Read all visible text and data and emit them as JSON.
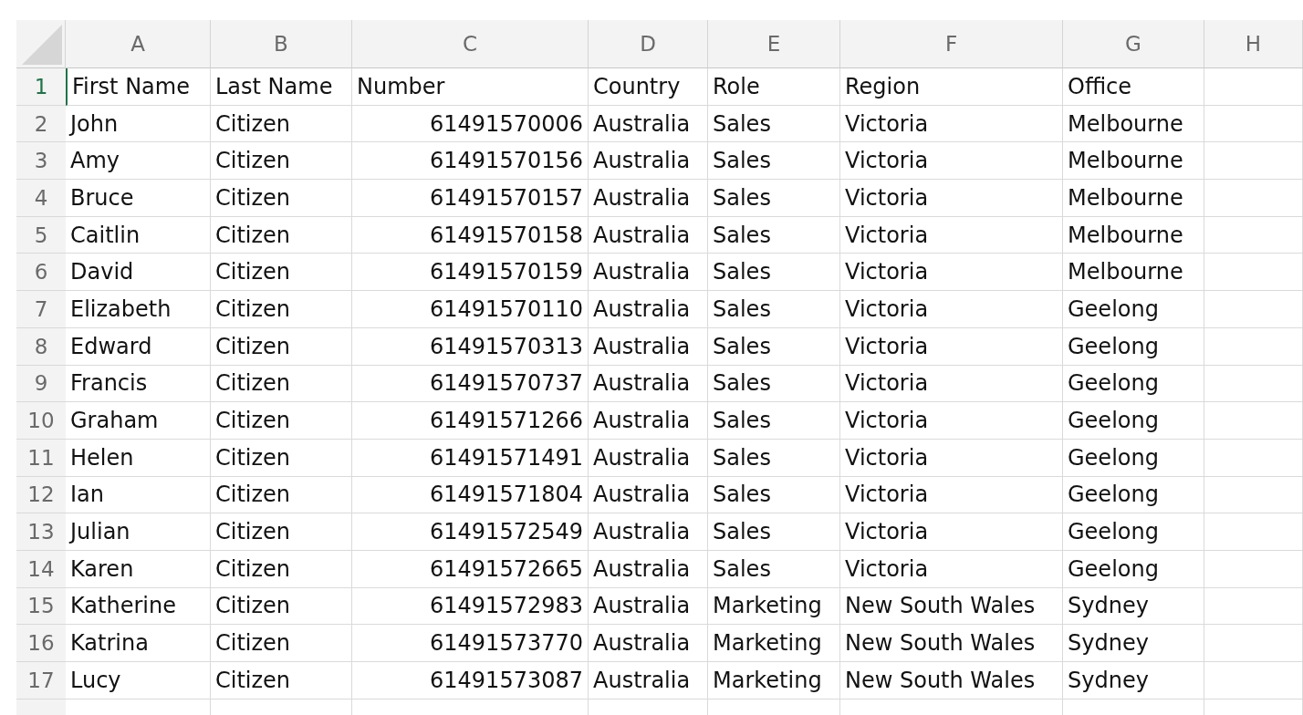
{
  "columns": [
    {
      "label": "A"
    },
    {
      "label": "B"
    },
    {
      "label": "C"
    },
    {
      "label": "D"
    },
    {
      "label": "E"
    },
    {
      "label": "F"
    },
    {
      "label": "G"
    },
    {
      "label": "H"
    }
  ],
  "rows": [
    {
      "number": "1",
      "selected": true,
      "cells": [
        "First Name",
        "Last Name",
        "Number",
        "Country",
        "Role",
        "Region",
        "Office"
      ]
    },
    {
      "number": "2",
      "selected": false,
      "cells": [
        "John",
        "Citizen",
        "61491570006",
        "Australia",
        "Sales",
        "Victoria",
        "Melbourne"
      ]
    },
    {
      "number": "3",
      "selected": false,
      "cells": [
        "Amy",
        "Citizen",
        "61491570156",
        "Australia",
        "Sales",
        "Victoria",
        "Melbourne"
      ]
    },
    {
      "number": "4",
      "selected": false,
      "cells": [
        "Bruce",
        "Citizen",
        "61491570157",
        "Australia",
        "Sales",
        "Victoria",
        "Melbourne"
      ]
    },
    {
      "number": "5",
      "selected": false,
      "cells": [
        "Caitlin",
        "Citizen",
        "61491570158",
        "Australia",
        "Sales",
        "Victoria",
        "Melbourne"
      ]
    },
    {
      "number": "6",
      "selected": false,
      "cells": [
        "David",
        "Citizen",
        "61491570159",
        "Australia",
        "Sales",
        "Victoria",
        "Melbourne"
      ]
    },
    {
      "number": "7",
      "selected": false,
      "cells": [
        "Elizabeth",
        "Citizen",
        "61491570110",
        "Australia",
        "Sales",
        "Victoria",
        "Geelong"
      ]
    },
    {
      "number": "8",
      "selected": false,
      "cells": [
        "Edward",
        "Citizen",
        "61491570313",
        "Australia",
        "Sales",
        "Victoria",
        "Geelong"
      ]
    },
    {
      "number": "9",
      "selected": false,
      "cells": [
        "Francis",
        "Citizen",
        "61491570737",
        "Australia",
        "Sales",
        "Victoria",
        "Geelong"
      ]
    },
    {
      "number": "10",
      "selected": false,
      "cells": [
        "Graham",
        "Citizen",
        "61491571266",
        "Australia",
        "Sales",
        "Victoria",
        "Geelong"
      ]
    },
    {
      "number": "11",
      "selected": false,
      "cells": [
        "Helen",
        "Citizen",
        "61491571491",
        "Australia",
        "Sales",
        "Victoria",
        "Geelong"
      ]
    },
    {
      "number": "12",
      "selected": false,
      "cells": [
        "Ian",
        "Citizen",
        "61491571804",
        "Australia",
        "Sales",
        "Victoria",
        "Geelong"
      ]
    },
    {
      "number": "13",
      "selected": false,
      "cells": [
        "Julian",
        "Citizen",
        "61491572549",
        "Australia",
        "Sales",
        "Victoria",
        "Geelong"
      ]
    },
    {
      "number": "14",
      "selected": false,
      "cells": [
        "Karen",
        "Citizen",
        "61491572665",
        "Australia",
        "Sales",
        "Victoria",
        "Geelong"
      ]
    },
    {
      "number": "15",
      "selected": false,
      "cells": [
        "Katherine",
        "Citizen",
        "61491572983",
        "Australia",
        "Marketing",
        "New South Wales",
        "Sydney"
      ]
    },
    {
      "number": "16",
      "selected": false,
      "cells": [
        "Katrina",
        "Citizen",
        "61491573770",
        "Australia",
        "Marketing",
        "New South Wales",
        "Sydney"
      ]
    },
    {
      "number": "17",
      "selected": false,
      "cells": [
        "Lucy",
        "Citizen",
        "61491573087",
        "Australia",
        "Marketing",
        "New South Wales",
        "Sydney"
      ]
    }
  ]
}
